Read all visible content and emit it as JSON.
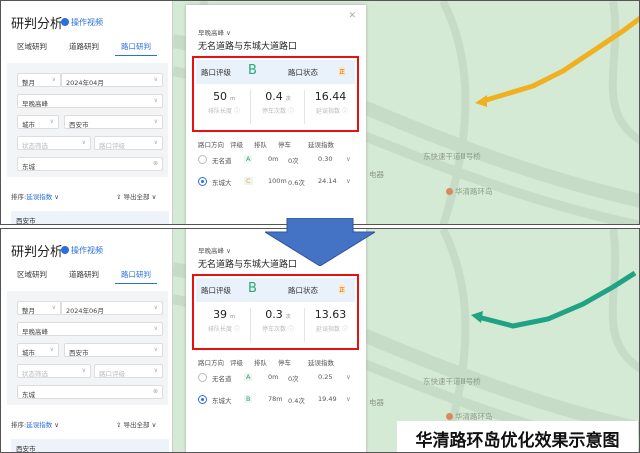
{
  "panels": [
    {
      "title": "研判分析",
      "video": "操作视频",
      "tabs": [
        "区域研判",
        "道路研判",
        "路口研判"
      ],
      "filters": {
        "period": "整月",
        "month": "2024年04月",
        "peak": "早晚高峰",
        "scope": "城市",
        "city": "西安市",
        "status_ph": "状态筛选",
        "grade_ph": "路口评级",
        "search": "东城"
      },
      "sort_label": "排序:",
      "sort_value": "延误指数",
      "export": "导出全部",
      "city_group": "西安市",
      "card": {
        "peak": "早晚高峰",
        "name": "无名道路与东城大道路口",
        "grade_label": "路口评级",
        "grade": "B",
        "status_label": "路口状态",
        "status": "正",
        "metrics": [
          {
            "value": "50",
            "unit": "m",
            "label": "排队长度"
          },
          {
            "value": "0.4",
            "unit": "次",
            "label": "停车次数"
          },
          {
            "value": "16.44",
            "unit": "",
            "label": "延误指数"
          }
        ],
        "dir_headers": [
          "路口方向",
          "评级",
          "排队",
          "停车",
          "延误指数"
        ],
        "dirs": [
          {
            "name": "无名道",
            "grade": "A",
            "queue": "0m",
            "stops": "0次",
            "delay": "0.30",
            "selected": false
          },
          {
            "name": "东城大",
            "grade": "C",
            "queue": "100m",
            "stops": "0.6次",
            "delay": "24.14",
            "selected": true
          }
        ]
      }
    },
    {
      "title": "研判分析",
      "video": "操作视频",
      "tabs": [
        "区域研判",
        "道路研判",
        "路口研判"
      ],
      "filters": {
        "period": "整月",
        "month": "2024年06月",
        "peak": "早晚高峰",
        "scope": "城市",
        "city": "西安市",
        "status_ph": "状态筛选",
        "grade_ph": "路口评级",
        "search": "东城"
      },
      "sort_label": "排序:",
      "sort_value": "延误指数",
      "export": "导出全部",
      "city_group": "西安市",
      "card": {
        "peak": "早晚高峰",
        "name": "无名道路与东城大道路口",
        "grade_label": "路口评级",
        "grade": "B",
        "status_label": "路口状态",
        "status": "正",
        "metrics": [
          {
            "value": "39",
            "unit": "m",
            "label": "排队长度"
          },
          {
            "value": "0.3",
            "unit": "次",
            "label": "停车次数"
          },
          {
            "value": "13.63",
            "unit": "",
            "label": "延误指数"
          }
        ],
        "dir_headers": [
          "路口方向",
          "评级",
          "排队",
          "停车",
          "延误指数"
        ],
        "dirs": [
          {
            "name": "无名道",
            "grade": "A",
            "queue": "0m",
            "stops": "0次",
            "delay": "0.25",
            "selected": false
          },
          {
            "name": "东城大",
            "grade": "B",
            "queue": "78m",
            "stops": "0.4次",
            "delay": "19.49",
            "selected": true
          }
        ]
      }
    }
  ],
  "map": {
    "bridge": "东快速干道Ⅲ号桥",
    "poi": "华清路环岛",
    "partial": "电器"
  },
  "route_colors": [
    "#f0b020",
    "#1fa383"
  ],
  "caption": "华清路环岛优化效果示意图"
}
